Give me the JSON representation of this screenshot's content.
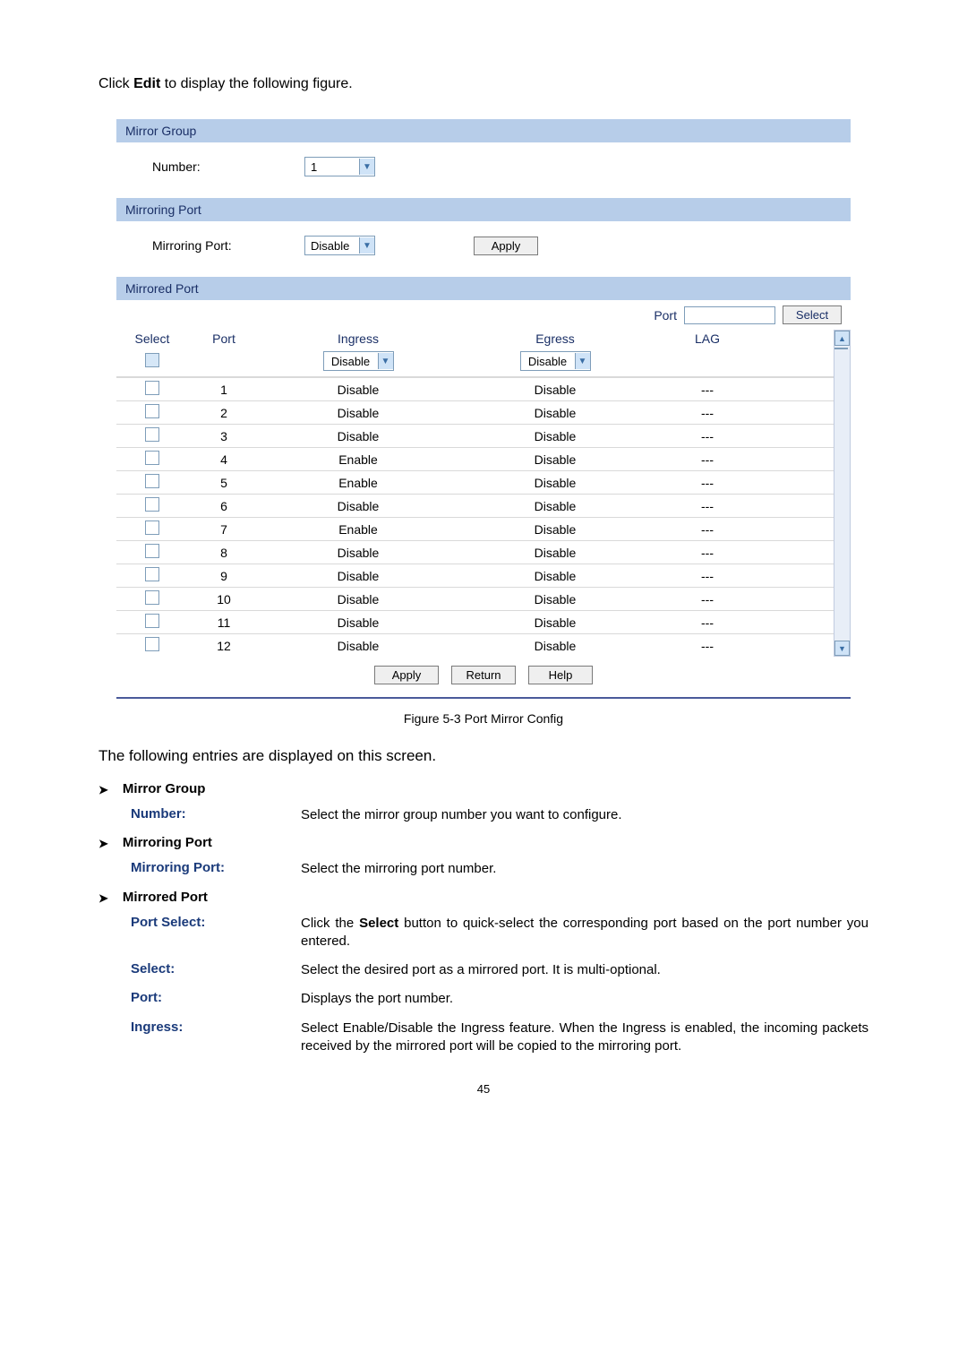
{
  "intro": {
    "prefix": "Click ",
    "bold": "Edit",
    "suffix": " to display the following figure."
  },
  "panel": {
    "mirrorGroup": {
      "title": "Mirror Group",
      "numberLabel": "Number:",
      "numberValue": "1"
    },
    "mirroringPort": {
      "title": "Mirroring Port",
      "label": "Mirroring Port:",
      "value": "Disable",
      "applyLabel": "Apply"
    },
    "mirroredPort": {
      "title": "Mirrored Port",
      "searchLabel": "Port",
      "selectBtn": "Select",
      "headers": {
        "select": "Select",
        "port": "Port",
        "ingress": "Ingress",
        "egress": "Egress",
        "lag": "LAG"
      },
      "filter": {
        "ingress": "Disable",
        "egress": "Disable"
      },
      "rows": [
        {
          "port": "1",
          "ingress": "Disable",
          "egress": "Disable",
          "lag": "---"
        },
        {
          "port": "2",
          "ingress": "Disable",
          "egress": "Disable",
          "lag": "---"
        },
        {
          "port": "3",
          "ingress": "Disable",
          "egress": "Disable",
          "lag": "---"
        },
        {
          "port": "4",
          "ingress": "Enable",
          "egress": "Disable",
          "lag": "---"
        },
        {
          "port": "5",
          "ingress": "Enable",
          "egress": "Disable",
          "lag": "---"
        },
        {
          "port": "6",
          "ingress": "Disable",
          "egress": "Disable",
          "lag": "---"
        },
        {
          "port": "7",
          "ingress": "Enable",
          "egress": "Disable",
          "lag": "---"
        },
        {
          "port": "8",
          "ingress": "Disable",
          "egress": "Disable",
          "lag": "---"
        },
        {
          "port": "9",
          "ingress": "Disable",
          "egress": "Disable",
          "lag": "---"
        },
        {
          "port": "10",
          "ingress": "Disable",
          "egress": "Disable",
          "lag": "---"
        },
        {
          "port": "11",
          "ingress": "Disable",
          "egress": "Disable",
          "lag": "---"
        },
        {
          "port": "12",
          "ingress": "Disable",
          "egress": "Disable",
          "lag": "---"
        }
      ],
      "buttons": {
        "apply": "Apply",
        "return": "Return",
        "help": "Help"
      }
    }
  },
  "figureCaption": "Figure 5-3 Port Mirror Config",
  "descIntro": "The following entries are displayed on this screen.",
  "entries": [
    {
      "heading": "Mirror Group",
      "items": [
        {
          "label": "Number:",
          "desc": "Select the mirror group number you want to configure."
        }
      ]
    },
    {
      "heading": "Mirroring Port",
      "items": [
        {
          "label": "Mirroring Port:",
          "desc": "Select the mirroring port number."
        }
      ]
    },
    {
      "heading": "Mirrored Port",
      "items": [
        {
          "label": "Port Select:",
          "descPrefix": "Click the ",
          "descBold": "Select",
          "descSuffix": " button to quick-select the corresponding port based on the port number you entered."
        },
        {
          "label": "Select:",
          "desc": "Select the desired port as a mirrored port. It is multi-optional."
        },
        {
          "label": "Port:",
          "desc": "Displays the port number."
        },
        {
          "label": "Ingress:",
          "desc": "Select Enable/Disable the Ingress feature. When the Ingress is enabled, the incoming packets received by the mirrored port will be copied to the mirroring port."
        }
      ]
    }
  ],
  "pageNumber": "45"
}
